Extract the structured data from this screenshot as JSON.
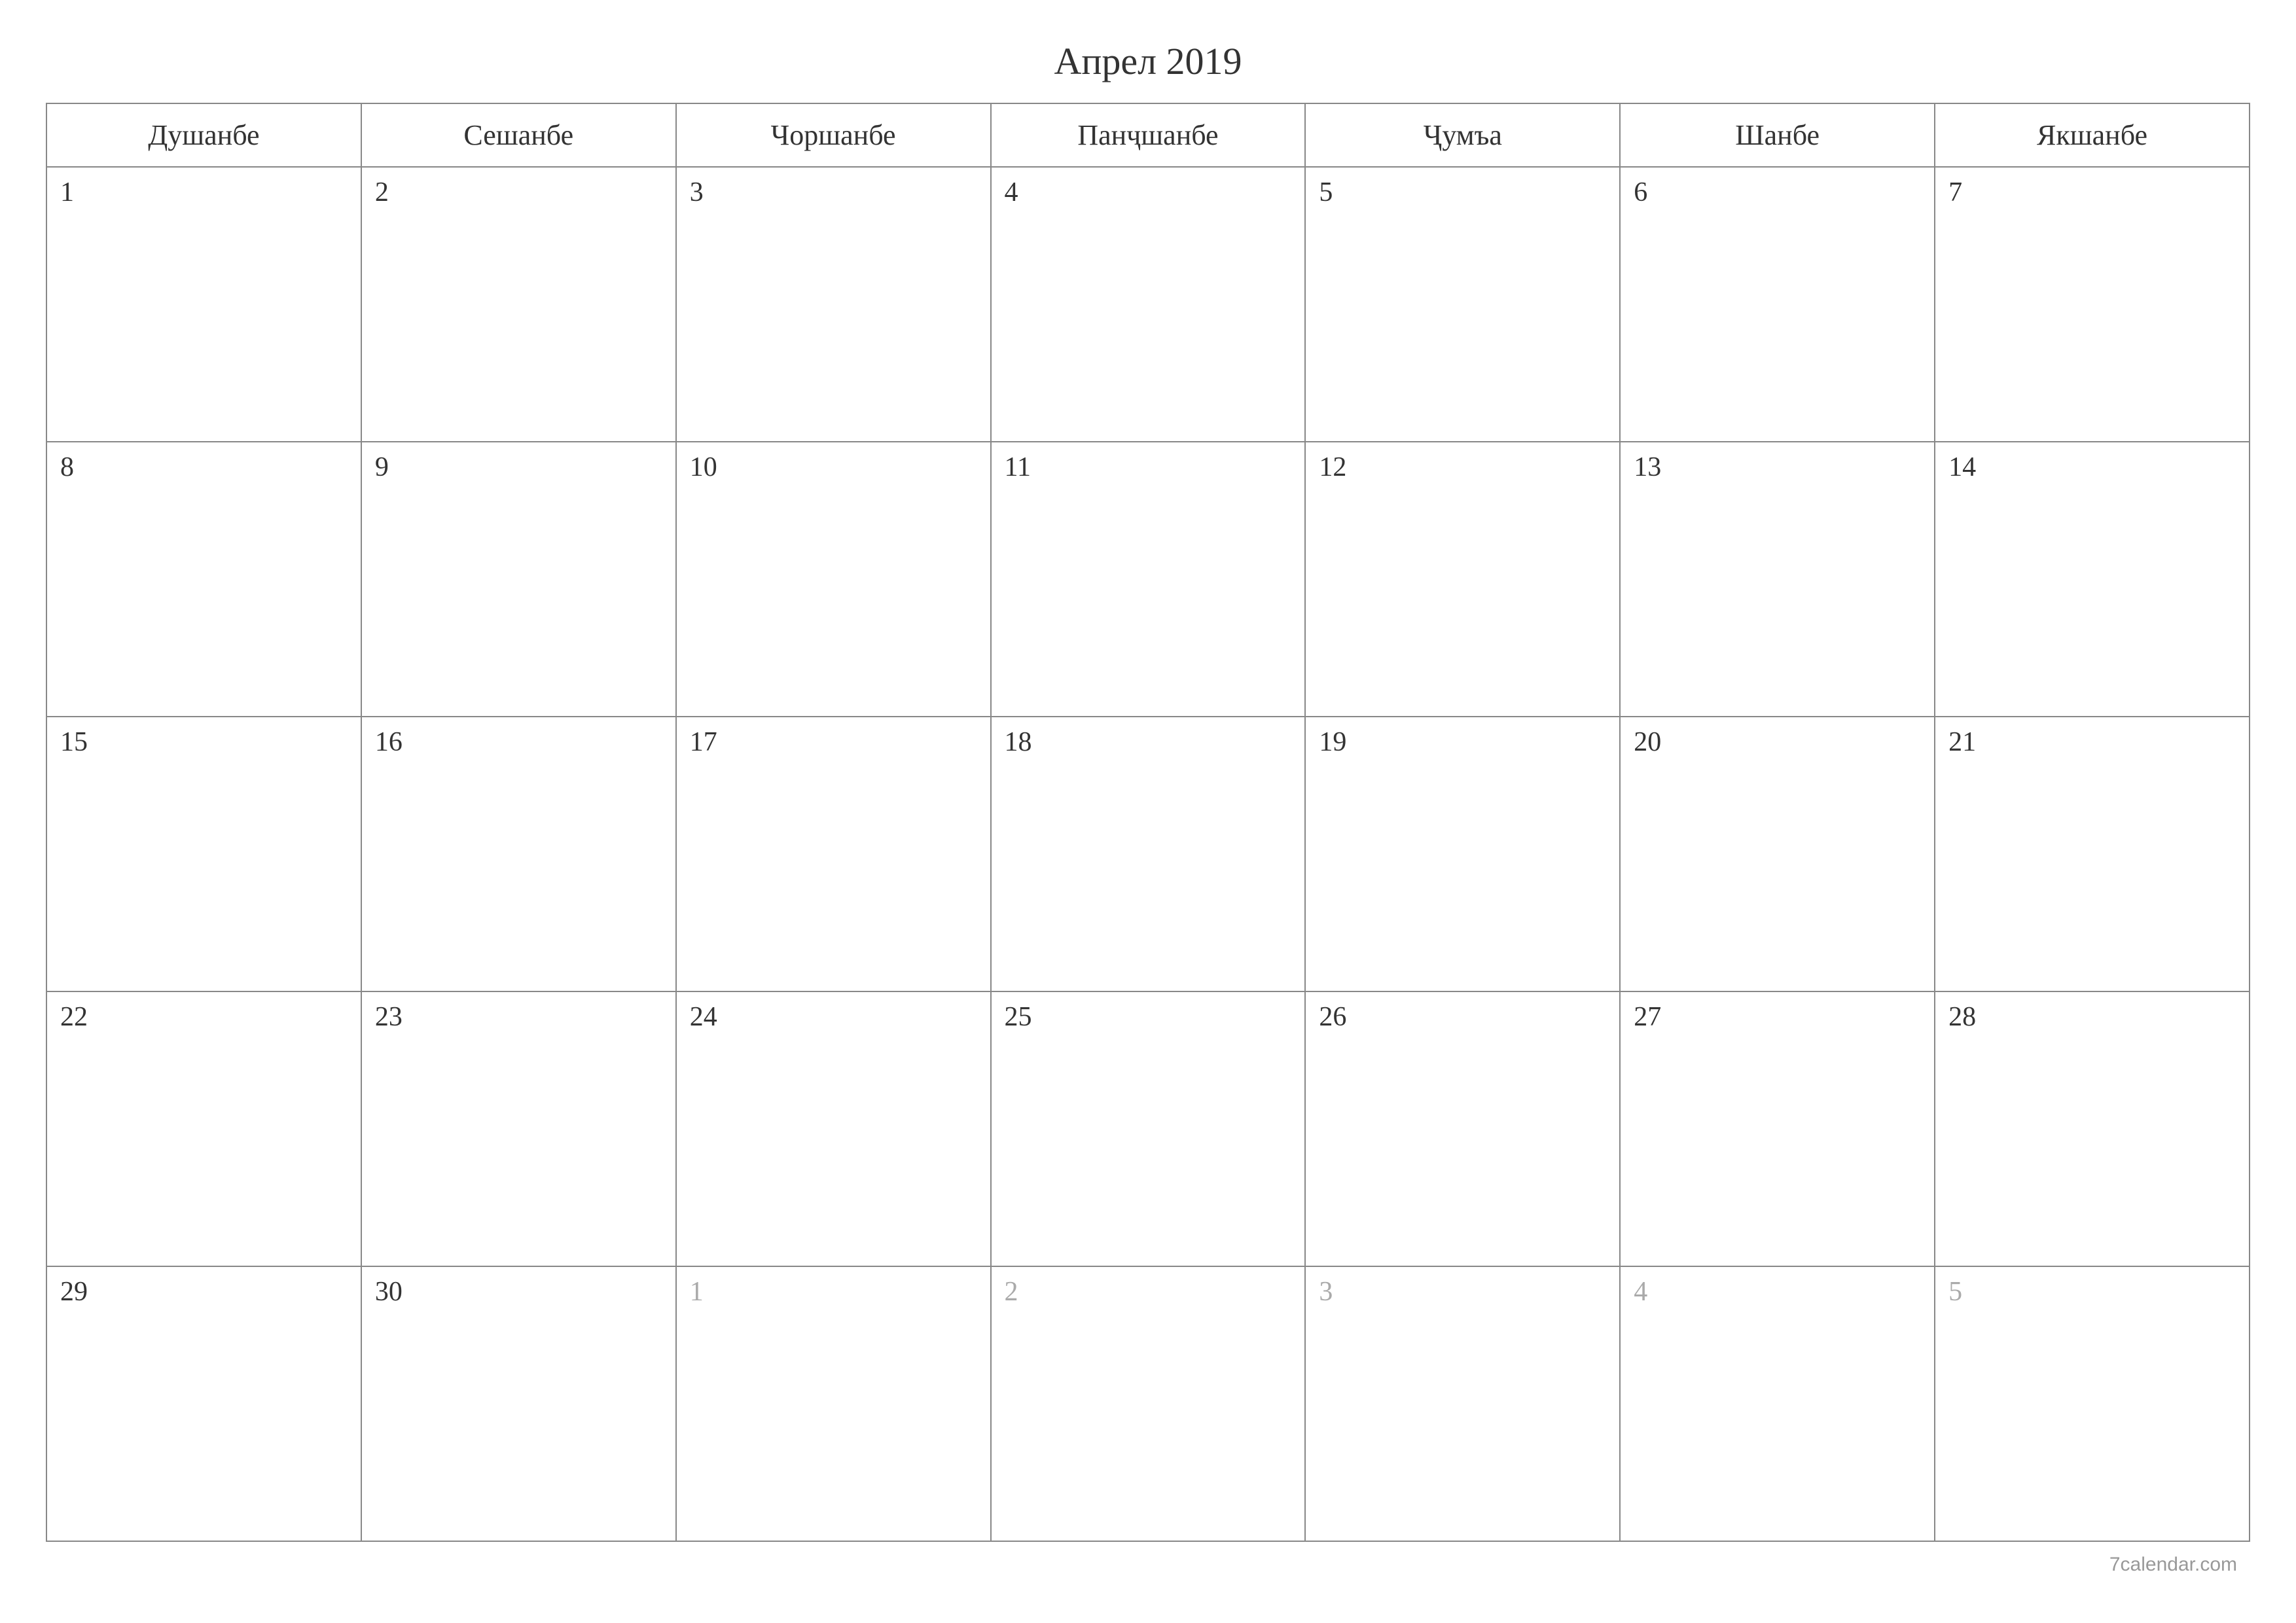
{
  "title": "Апрел 2019",
  "weekdays": [
    "Душанбе",
    "Сешанбе",
    "Чоршанбе",
    "Панҷшанбе",
    "Ҷумъа",
    "Шанбе",
    "Якшанбе"
  ],
  "weeks": [
    [
      {
        "day": "1",
        "muted": false
      },
      {
        "day": "2",
        "muted": false
      },
      {
        "day": "3",
        "muted": false
      },
      {
        "day": "4",
        "muted": false
      },
      {
        "day": "5",
        "muted": false
      },
      {
        "day": "6",
        "muted": false
      },
      {
        "day": "7",
        "muted": false
      }
    ],
    [
      {
        "day": "8",
        "muted": false
      },
      {
        "day": "9",
        "muted": false
      },
      {
        "day": "10",
        "muted": false
      },
      {
        "day": "11",
        "muted": false
      },
      {
        "day": "12",
        "muted": false
      },
      {
        "day": "13",
        "muted": false
      },
      {
        "day": "14",
        "muted": false
      }
    ],
    [
      {
        "day": "15",
        "muted": false
      },
      {
        "day": "16",
        "muted": false
      },
      {
        "day": "17",
        "muted": false
      },
      {
        "day": "18",
        "muted": false
      },
      {
        "day": "19",
        "muted": false
      },
      {
        "day": "20",
        "muted": false
      },
      {
        "day": "21",
        "muted": false
      }
    ],
    [
      {
        "day": "22",
        "muted": false
      },
      {
        "day": "23",
        "muted": false
      },
      {
        "day": "24",
        "muted": false
      },
      {
        "day": "25",
        "muted": false
      },
      {
        "day": "26",
        "muted": false
      },
      {
        "day": "27",
        "muted": false
      },
      {
        "day": "28",
        "muted": false
      }
    ],
    [
      {
        "day": "29",
        "muted": false
      },
      {
        "day": "30",
        "muted": false
      },
      {
        "day": "1",
        "muted": true
      },
      {
        "day": "2",
        "muted": true
      },
      {
        "day": "3",
        "muted": true
      },
      {
        "day": "4",
        "muted": true
      },
      {
        "day": "5",
        "muted": true
      }
    ]
  ],
  "footer": "7calendar.com"
}
